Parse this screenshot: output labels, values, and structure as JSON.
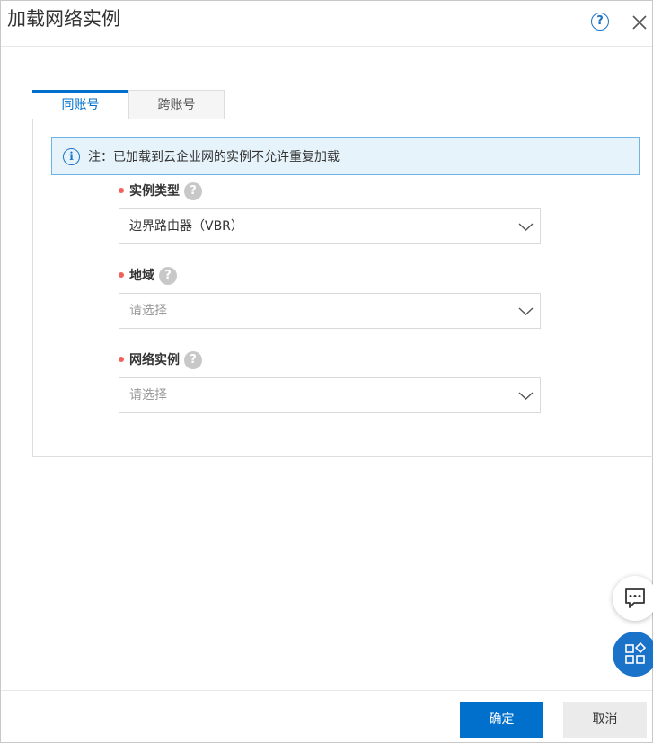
{
  "dialog": {
    "title": "加载网络实例",
    "help_icon": "question-circle-icon",
    "close_icon": "close-icon"
  },
  "tabs": [
    {
      "label": "同账号",
      "active": true
    },
    {
      "label": "跨账号",
      "active": false
    }
  ],
  "notice": {
    "icon": "info-icon",
    "text": "注：已加载到云企业网的实例不允许重复加载"
  },
  "form": {
    "fields": [
      {
        "label": "实例类型",
        "required": true,
        "help": "?",
        "value": "边界路由器（VBR）",
        "placeholder": ""
      },
      {
        "label": "地域",
        "required": true,
        "help": "?",
        "value": "",
        "placeholder": "请选择"
      },
      {
        "label": "网络实例",
        "required": true,
        "help": "?",
        "value": "",
        "placeholder": "请选择"
      }
    ]
  },
  "footer": {
    "ok_label": "确定",
    "cancel_label": "取消"
  },
  "floating": {
    "chat_icon": "chat-bubble-icon",
    "apps_icon": "apps-grid-icon"
  },
  "colors": {
    "primary": "#0070cc",
    "notice_bg": "#e6f3fb",
    "notice_border": "#6cb5e2",
    "required_dot": "#f0625b"
  }
}
